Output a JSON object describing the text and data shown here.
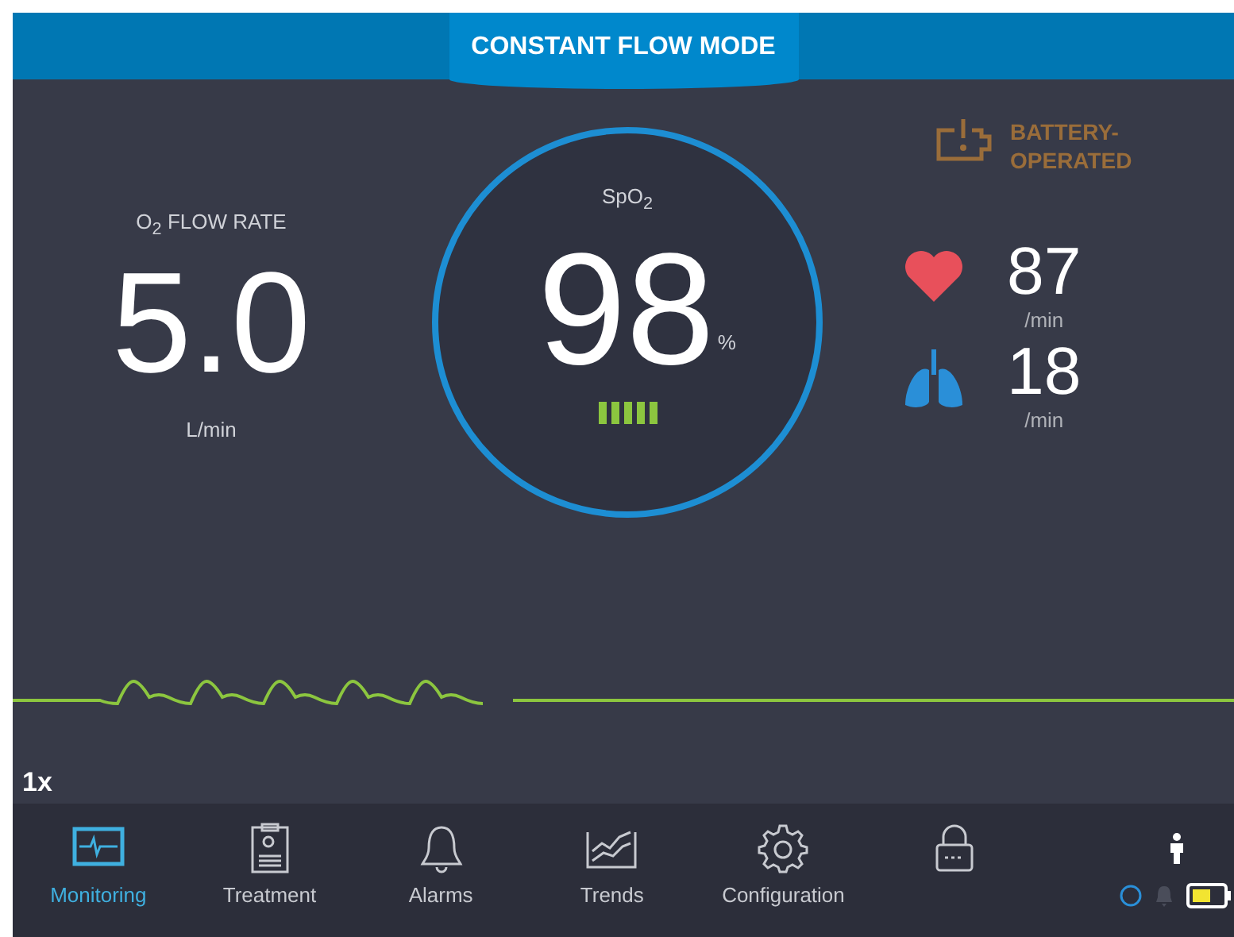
{
  "header": {
    "mode": "CONSTANT FLOW MODE"
  },
  "flow": {
    "label": "O$_{2}$ FLOW RATE",
    "value": "5.0",
    "unit": "L/min"
  },
  "spo2": {
    "label": "SpO$_{2}$",
    "value": "98",
    "unit": "%"
  },
  "battery_warning": {
    "text": "BATTERY-\nOPERATED"
  },
  "vitals": [
    {
      "kind": "heart",
      "value": "87",
      "unit": "/min"
    },
    {
      "kind": "lungs",
      "value": "18",
      "unit": "/min"
    }
  ],
  "waveform": {
    "speed": "1x"
  },
  "nav": [
    {
      "kind": "monitor",
      "label": "Monitoring",
      "selected": true
    },
    {
      "kind": "clipboard",
      "label": "Treatment",
      "selected": false
    },
    {
      "kind": "bell",
      "label": "Alarms",
      "selected": false
    },
    {
      "kind": "chart",
      "label": "Trends",
      "selected": false
    },
    {
      "kind": "gear",
      "label": "Configuration",
      "selected": false
    },
    {
      "kind": "lock",
      "selected": false
    }
  ]
}
